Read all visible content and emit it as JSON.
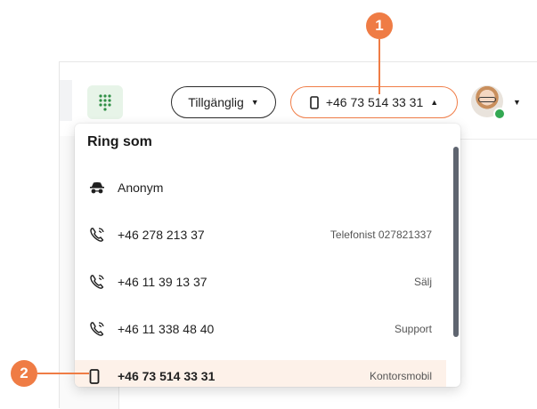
{
  "toolbar": {
    "status_label": "Tillgänglig",
    "caller_id_label": "+46 73 514 33 31"
  },
  "dropdown": {
    "title": "Ring som",
    "items": [
      {
        "icon": "incognito-icon",
        "number": "Anonym",
        "tag": ""
      },
      {
        "icon": "phone-forward-icon",
        "number": "+46 278 213 37",
        "tag": "Telefonist 027821337"
      },
      {
        "icon": "phone-forward-icon",
        "number": "+46 11 39 13 37",
        "tag": "Sälj"
      },
      {
        "icon": "phone-forward-icon",
        "number": "+46 11 338 48 40",
        "tag": "Support"
      },
      {
        "icon": "mobile-icon",
        "number": "+46 73 514 33 31",
        "tag": "Kontorsmobil",
        "selected": true
      }
    ]
  },
  "callouts": [
    "1",
    "2"
  ],
  "colors": {
    "accent": "#ef7c45",
    "presence": "#33a852",
    "selected_row": "#fdf1e9",
    "dialpad_bg": "#e7f4e8"
  }
}
